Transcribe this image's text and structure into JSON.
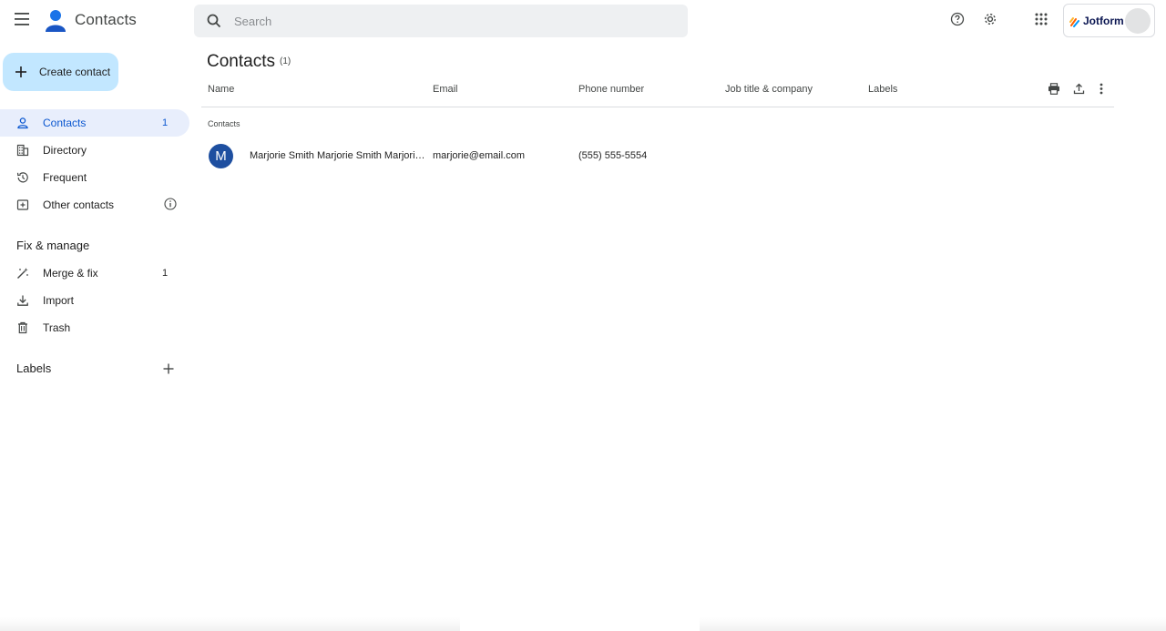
{
  "header": {
    "app_title": "Contacts",
    "search_placeholder": "Search",
    "account_name": "Jotform"
  },
  "sidebar": {
    "create_label": "Create contact",
    "items": [
      {
        "label": "Contacts",
        "count": "1",
        "icon": "person-icon",
        "active": true
      },
      {
        "label": "Directory",
        "count": "",
        "icon": "building-icon"
      },
      {
        "label": "Frequent",
        "count": "",
        "icon": "history-icon"
      },
      {
        "label": "Other contacts",
        "count": "",
        "icon": "other-contacts-icon"
      }
    ],
    "fix_title": "Fix & manage",
    "fix_items": [
      {
        "label": "Merge & fix",
        "count": "1",
        "icon": "magic-wand-icon"
      },
      {
        "label": "Import",
        "count": "",
        "icon": "download-icon"
      },
      {
        "label": "Trash",
        "count": "",
        "icon": "trash-icon"
      }
    ],
    "labels_title": "Labels"
  },
  "main": {
    "title": "Contacts",
    "count": "(1)",
    "columns": [
      "Name",
      "Email",
      "Phone number",
      "Job title & company",
      "Labels"
    ],
    "group_label": "Contacts",
    "rows": [
      {
        "initial": "M",
        "name": "Marjorie Smith Marjorie Smith Marjorie Smith",
        "email": "marjorie@email.com",
        "phone": "(555) 555-5554",
        "avatar_color": "#1e4fa0"
      }
    ]
  },
  "colors": {
    "accent": "#0b57d0",
    "create_bg": "#c2e7ff",
    "active_bg": "#e8eefc"
  }
}
